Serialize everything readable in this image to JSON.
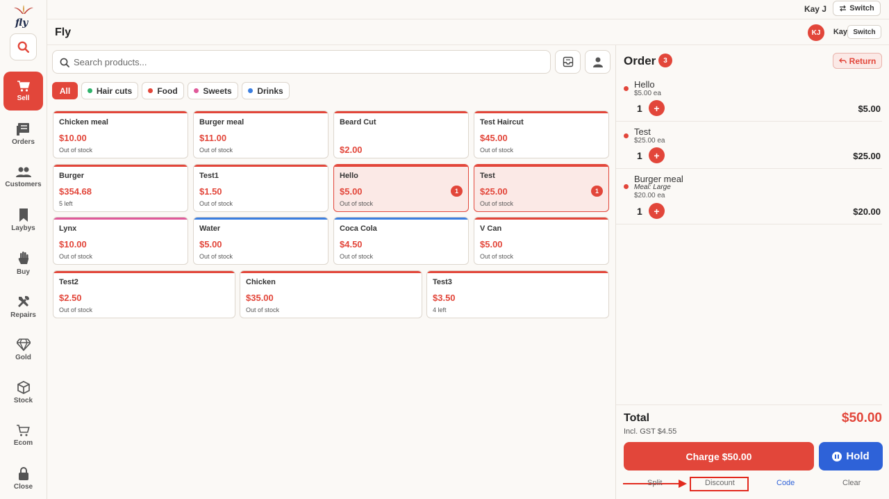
{
  "app": {
    "logo_text": "fly",
    "title": "Fly"
  },
  "topbar": {
    "user": "Kay J",
    "switch_label": "Switch"
  },
  "header": {
    "initials": "KJ",
    "user_name": "Kay",
    "switch_label": "Switch"
  },
  "sidebar": {
    "search_icon": "search-icon",
    "items": [
      {
        "label": "Sell",
        "icon": "cart-icon",
        "active": true
      },
      {
        "label": "Orders",
        "icon": "orders-icon"
      },
      {
        "label": "Customers",
        "icon": "users-icon"
      },
      {
        "label": "Laybys",
        "icon": "bookmark-icon"
      },
      {
        "label": "Buy",
        "icon": "hand-icon"
      },
      {
        "label": "Repairs",
        "icon": "tools-icon"
      },
      {
        "label": "Gold",
        "icon": "diamond-icon"
      },
      {
        "label": "Stock",
        "icon": "box-icon"
      },
      {
        "label": "Ecom",
        "icon": "ecom-cart-icon"
      },
      {
        "label": "Close",
        "icon": "lock-icon"
      }
    ]
  },
  "search": {
    "placeholder": "Search products..."
  },
  "categories": [
    {
      "label": "All",
      "active": true
    },
    {
      "label": "Hair cuts",
      "color": "#2fb36b"
    },
    {
      "label": "Food",
      "color": "#e2463a"
    },
    {
      "label": "Sweets",
      "color": "#e05a9a"
    },
    {
      "label": "Drinks",
      "color": "#3b7ee0"
    }
  ],
  "products": [
    {
      "name": "Chicken meal",
      "price": "$10.00",
      "stock": "Out of stock",
      "color": "#e2463a"
    },
    {
      "name": "Burger meal",
      "price": "$11.00",
      "stock": "Out of stock",
      "color": "#e2463a"
    },
    {
      "name": "Beard Cut",
      "price": "$2.00",
      "stock": "",
      "color": "#e2463a"
    },
    {
      "name": "Test Haircut",
      "price": "$45.00",
      "stock": "Out of stock",
      "color": "#e2463a"
    },
    {
      "name": "Burger",
      "price": "$354.68",
      "stock": "5 left",
      "color": "#e2463a"
    },
    {
      "name": "Test1",
      "price": "$1.50",
      "stock": "Out of stock",
      "color": "#e2463a"
    },
    {
      "name": "Hello",
      "price": "$5.00",
      "stock": "Out of stock",
      "color": "#e2463a",
      "qty": "1"
    },
    {
      "name": "Test",
      "price": "$25.00",
      "stock": "Out of stock",
      "color": "#e2463a",
      "qty": "1"
    },
    {
      "name": "Lynx",
      "price": "$10.00",
      "stock": "Out of stock",
      "color": "#e05a9a"
    },
    {
      "name": "Water",
      "price": "$5.00",
      "stock": "Out of stock",
      "color": "#3b7ee0"
    },
    {
      "name": "Coca Cola",
      "price": "$4.50",
      "stock": "Out of stock",
      "color": "#3b7ee0"
    },
    {
      "name": "V Can",
      "price": "$5.00",
      "stock": "Out of stock",
      "color": "#e2463a"
    },
    {
      "name": "Test2",
      "price": "$2.50",
      "stock": "Out of stock",
      "color": "#e2463a"
    },
    {
      "name": "Chicken",
      "price": "$35.00",
      "stock": "Out of stock",
      "color": "#e2463a"
    },
    {
      "name": "Test3",
      "price": "$3.50",
      "stock": "4 left",
      "color": "#e2463a"
    }
  ],
  "order": {
    "title": "Order",
    "count": "3",
    "return_label": "Return",
    "items": [
      {
        "name": "Hello",
        "each": "$5.00 ea",
        "qty": "1",
        "total": "$5.00"
      },
      {
        "name": "Test",
        "each": "$25.00 ea",
        "qty": "1",
        "total": "$25.00"
      },
      {
        "name": "Burger meal",
        "modifier": "Meal: Large",
        "each": "$20.00 ea",
        "qty": "1",
        "total": "$20.00"
      }
    ],
    "total_label": "Total",
    "gst": "Incl. GST $4.55",
    "total": "$50.00",
    "charge_label": "Charge $50.00",
    "hold_label": "Hold",
    "actions": {
      "split": "Split",
      "discount": "Discount",
      "code": "Code",
      "clear": "Clear"
    }
  }
}
